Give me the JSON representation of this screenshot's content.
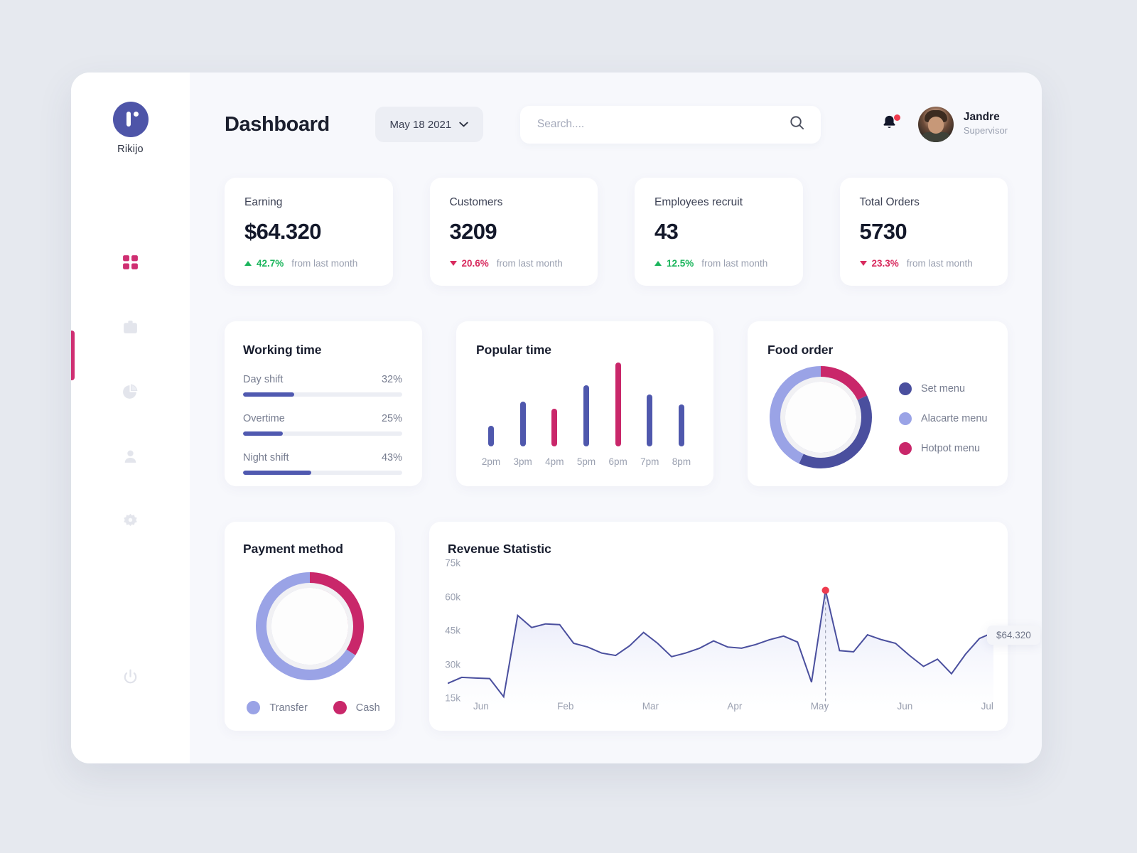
{
  "brand": {
    "name": "Rikijo",
    "logo_color": "#4e55a8"
  },
  "sidebar": {
    "active_index": 0,
    "items": [
      {
        "icon": "grid-icon",
        "name": "dashboard",
        "active": true
      },
      {
        "icon": "clipboard-icon",
        "name": "tasks",
        "active": false
      },
      {
        "icon": "pie-chart-icon",
        "name": "reports",
        "active": false
      },
      {
        "icon": "user-icon",
        "name": "profile",
        "active": false
      },
      {
        "icon": "gear-icon",
        "name": "settings",
        "active": false
      },
      {
        "icon": "power-icon",
        "name": "logout",
        "active": false
      }
    ],
    "active_color": "#cf2f72",
    "inactive_color": "#e3e5ec"
  },
  "header": {
    "title": "Dashboard",
    "date": "May 18 2021",
    "search_placeholder": "Search....",
    "search_value": "",
    "notification_badge": true,
    "user": {
      "name": "Jandre",
      "role": "Supervisor"
    }
  },
  "stats": [
    {
      "label": "Earning",
      "value": "$64.320",
      "delta": "42.7%",
      "direction": "up",
      "note": "from last month"
    },
    {
      "label": "Customers",
      "value": "3209",
      "delta": "20.6%",
      "direction": "down",
      "note": "from last month"
    },
    {
      "label": "Employees recruit",
      "value": "43",
      "delta": "12.5%",
      "direction": "up",
      "note": "from last month"
    },
    {
      "label": "Total Orders",
      "value": "5730",
      "delta": "23.3%",
      "direction": "down",
      "note": "from last month"
    }
  ],
  "working_time": {
    "title": "Working time",
    "bars": [
      {
        "label": "Day shift",
        "pct_text": "32%",
        "pct": 32
      },
      {
        "label": "Overtime",
        "pct_text": "25%",
        "pct": 25
      },
      {
        "label": "Night shift",
        "pct_text": "43%",
        "pct": 43
      }
    ],
    "fill_color": "#5059b0",
    "track_color": "#eceef4"
  },
  "popular_time": {
    "title": "Popular time"
  },
  "food_order": {
    "title": "Food order",
    "legend": [
      {
        "label": "Set menu",
        "color": "#4a4f9e"
      },
      {
        "label": "Alacarte menu",
        "color": "#9aa3e6"
      },
      {
        "label": "Hotpot menu",
        "color": "#c9276a"
      }
    ]
  },
  "payment_method": {
    "title": "Payment method",
    "legend": [
      {
        "label": "Transfer",
        "color": "#9aa3e6"
      },
      {
        "label": "Cash",
        "color": "#c9276a"
      }
    ]
  },
  "revenue": {
    "title": "Revenue Statistic",
    "tooltip": "$64.320"
  },
  "chart_data": [
    {
      "type": "bar",
      "title": "Popular time",
      "categories": [
        "2pm",
        "3pm",
        "4pm",
        "5pm",
        "6pm",
        "7pm",
        "8pm"
      ],
      "values": [
        25,
        53,
        45,
        73,
        100,
        62,
        50
      ],
      "colors": [
        "#4f58ad",
        "#4f58ad",
        "#c9276a",
        "#4f58ad",
        "#c9276a",
        "#4f58ad",
        "#4f58ad"
      ],
      "xlabel": "",
      "ylabel": "",
      "ylim": [
        0,
        100
      ],
      "grid": false,
      "legend": "none"
    },
    {
      "type": "pie",
      "title": "Food order",
      "labels": [
        "Hotpot menu",
        "Set menu",
        "Alacarte menu"
      ],
      "values": [
        18,
        39,
        43
      ],
      "colors": [
        "#c9276a",
        "#4a4f9e",
        "#9aa3e6"
      ],
      "donut": true,
      "legend": "right"
    },
    {
      "type": "pie",
      "title": "Payment method",
      "labels": [
        "Cash",
        "Transfer"
      ],
      "values": [
        34,
        66
      ],
      "colors": [
        "#c9276a",
        "#9aa3e6"
      ],
      "donut": true,
      "legend": "bottom"
    },
    {
      "type": "area",
      "title": "Revenue Statistic",
      "xlabel": "",
      "ylabel": "",
      "ylim": [
        15000,
        75000
      ],
      "ytick_labels": [
        "15k",
        "30k",
        "45k",
        "60k",
        "75k"
      ],
      "ytick_values": [
        15000,
        30000,
        45000,
        60000,
        75000
      ],
      "xtick_labels": [
        "Jun",
        "Feb",
        "Mar",
        "Apr",
        "May",
        "Jun",
        "Jul"
      ],
      "grid": false,
      "line_color": "#4a4f9e",
      "marker": {
        "x_label": "May",
        "value": 64320,
        "value_text": "$64.320",
        "color": "#ef3b4e"
      },
      "values": [
        26000,
        28500,
        28200,
        28000,
        20500,
        54000,
        49000,
        50500,
        50200,
        42500,
        41000,
        38500,
        37500,
        41500,
        47000,
        42500,
        37000,
        38500,
        40500,
        43500,
        41000,
        40500,
        42000,
        44000,
        45500,
        43000,
        26500,
        64320,
        39500,
        39000,
        46000,
        44000,
        42500,
        37500,
        33000,
        36000,
        30000,
        38000,
        44500,
        47000
      ],
      "legend": "none"
    }
  ]
}
